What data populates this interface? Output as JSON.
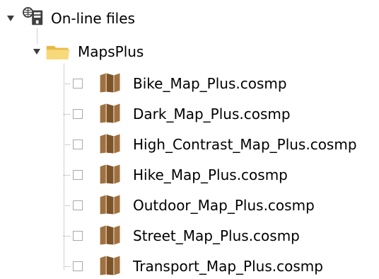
{
  "tree": {
    "root": {
      "label": "On-line files",
      "icon": "online-files-icon",
      "expanded": true
    },
    "folder": {
      "label": "MapsPlus",
      "icon": "folder-icon",
      "expanded": true,
      "color": "#f5d469"
    },
    "files": [
      {
        "label": "Bike_Map_Plus.cosmp",
        "checked": false,
        "icon": "map-icon"
      },
      {
        "label": "Dark_Map_Plus.cosmp",
        "checked": false,
        "icon": "map-icon"
      },
      {
        "label": "High_Contrast_Map_Plus.cosmp",
        "checked": false,
        "icon": "map-icon"
      },
      {
        "label": "Hike_Map_Plus.cosmp",
        "checked": false,
        "icon": "map-icon"
      },
      {
        "label": "Outdoor_Map_Plus.cosmp",
        "checked": false,
        "icon": "map-icon"
      },
      {
        "label": "Street_Map_Plus.cosmp",
        "checked": false,
        "icon": "map-icon"
      },
      {
        "label": "Transport_Map_Plus.cosmp",
        "checked": false,
        "icon": "map-icon"
      }
    ],
    "colors": {
      "map_icon": "#a0713f",
      "map_icon_dark": "#7d5328",
      "checkbox_border": "#a9a9a9",
      "tree_lines": "#a0a0a0"
    }
  }
}
